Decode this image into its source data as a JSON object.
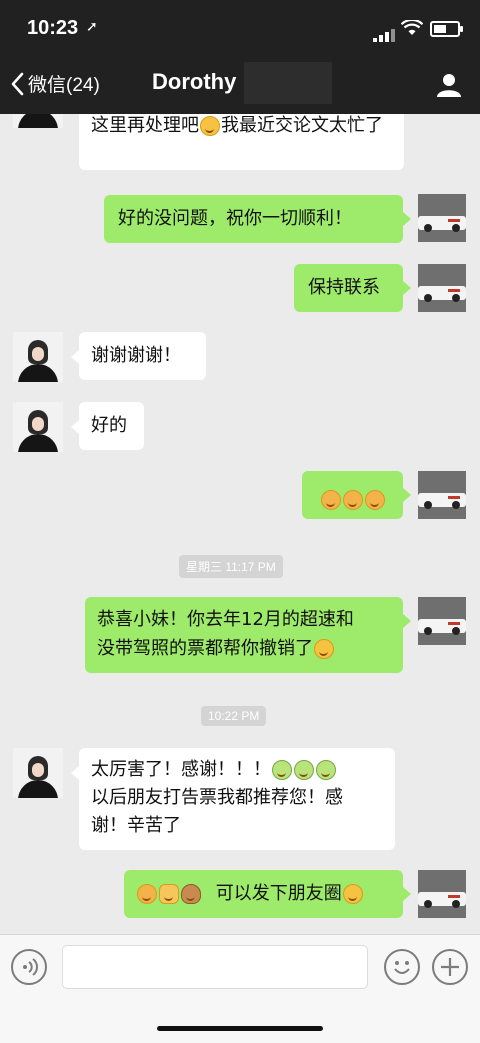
{
  "status_bar": {
    "time": "10:23"
  },
  "nav": {
    "back_label": "微信(24)",
    "title": "Dorothy"
  },
  "messages": [
    {
      "side": "in",
      "text_before": "这里再处理吧",
      "text_after": "我最近交论文太忙了"
    },
    {
      "side": "out",
      "text": "好的没问题，祝你一切顺利！"
    },
    {
      "side": "out",
      "text": "保持联系"
    },
    {
      "side": "in",
      "text": "谢谢谢谢！"
    },
    {
      "side": "in",
      "text": "好的"
    },
    {
      "side": "out",
      "emojis": [
        "bow",
        "bow",
        "bow"
      ]
    },
    {
      "side": "out",
      "text_line1": "恭喜小妹！你去年12月的超速和",
      "text_line2": "没带驾照的票都帮你撤销了"
    },
    {
      "side": "in",
      "text_line1": "太厉害了！感谢！！！",
      "text_line2": "以后朋友打告票我都推荐您！感",
      "text_line3": "谢！辛苦了"
    },
    {
      "side": "out",
      "text": "可以发下朋友圈"
    }
  ],
  "timestamps": [
    "星期三 11:17 PM",
    "10:22 PM"
  ],
  "icons": {
    "back": "chevron-left-icon",
    "profile": "person-icon",
    "voice": "voice-icon",
    "emoji": "emoji-icon",
    "plus": "plus-icon"
  },
  "colors": {
    "header_bg": "#212121",
    "chat_bg": "#ebebeb",
    "sent_bubble": "#9eea6a",
    "received_bubble": "#ffffff"
  }
}
